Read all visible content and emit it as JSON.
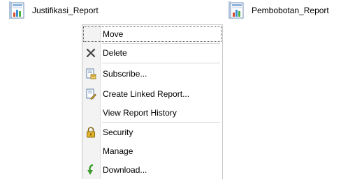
{
  "reports": [
    {
      "name": "Justifikasi_Report",
      "icon": "report-icon"
    },
    {
      "name": "Pembobotan_Report",
      "icon": "report-icon"
    }
  ],
  "context_menu": {
    "items": [
      {
        "label": "Move",
        "icon": "",
        "focused": true
      },
      {
        "label": "Delete",
        "icon": "delete-icon"
      },
      {
        "label": "Subscribe...",
        "icon": "subscribe-icon"
      },
      {
        "label": "Create Linked Report...",
        "icon": "linked-report-icon"
      },
      {
        "label": "View Report History",
        "icon": ""
      },
      {
        "label": "Security",
        "icon": "lock-icon"
      },
      {
        "label": "Manage",
        "icon": ""
      },
      {
        "label": "Download...",
        "icon": "download-icon"
      }
    ]
  },
  "colors": {
    "gutter": "#f3f3f3",
    "menu_border": "#c8c8c8",
    "separator": "#d7d7d7",
    "download_arrow": "#3a9a2a",
    "lock": "#d8a520"
  }
}
